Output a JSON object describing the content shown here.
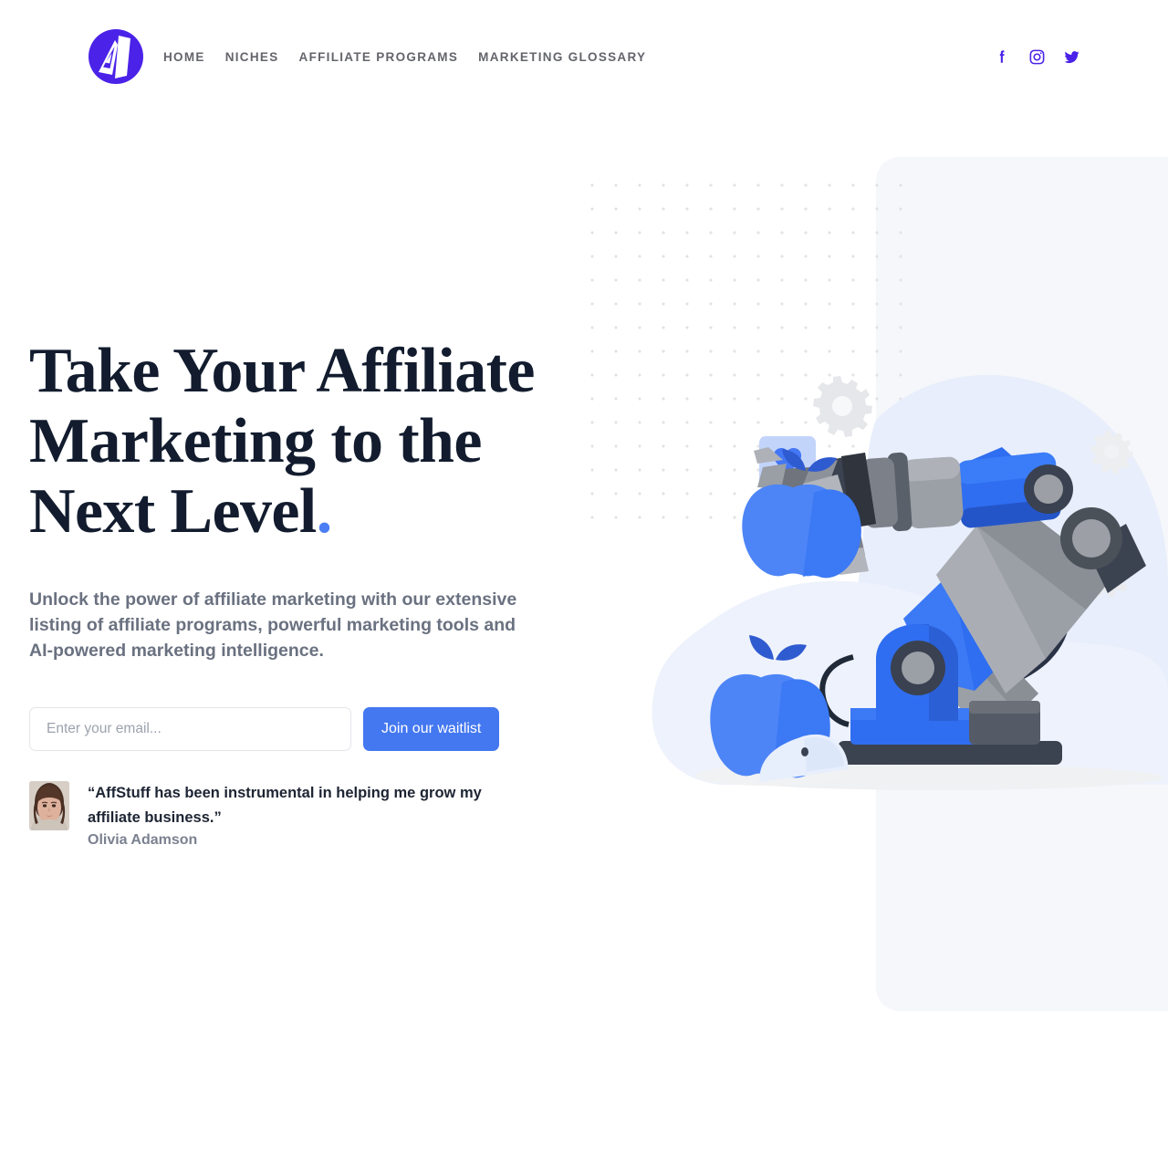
{
  "header": {
    "logo": {
      "icon": "affstuff-logo-icon",
      "alt": "AffStuff",
      "color": "#4b22e8"
    },
    "nav": [
      {
        "label": "HOME",
        "name": "nav-link-home"
      },
      {
        "label": "NICHES",
        "name": "nav-link-niches"
      },
      {
        "label": "AFFILIATE PROGRAMS",
        "name": "nav-link-affiliate-programs"
      },
      {
        "label": "MARKETING GLOSSARY",
        "name": "nav-link-marketing-glossary"
      }
    ],
    "socials": [
      {
        "icon": "facebook-icon",
        "label": "Facebook"
      },
      {
        "icon": "instagram-icon",
        "label": "Instagram"
      },
      {
        "icon": "twitter-icon",
        "label": "Twitter"
      }
    ],
    "social_color": "#4b22e8"
  },
  "hero": {
    "headline_line1": "Take Your Affiliate",
    "headline_line2": "Marketing to the",
    "headline_line3": "Next Level",
    "headline_period": ".",
    "subheading": "Unlock the power of affiliate marketing with our extensive listing of affiliate programs, powerful marketing tools and AI-powered marketing intelligence.",
    "form": {
      "email_placeholder": "Enter your email...",
      "email_value": "",
      "submit_label": "Join our waitlist"
    },
    "testimonial": {
      "quote": "“AffStuff has been instrumental in helping me grow my affiliate business.”",
      "author": "Olivia Adamson",
      "avatar": "avatar-olivia-adamson"
    }
  },
  "illustration": {
    "name": "robot-arm-holding-apple-illustration",
    "elements": [
      "dot-grid-pattern",
      "background-panel",
      "blue-blob",
      "heart-speech-bubble",
      "gear-decoration",
      "robotic-arm",
      "blue-apple",
      "apple-slice"
    ]
  },
  "colors": {
    "accent_blue": "#4478f0",
    "brand_purple": "#4b22e8",
    "headline": "#121c2e",
    "body_text": "#6a7180",
    "panel_bg": "#f5f7fa",
    "blob_blue": "#e8eefb",
    "bubble_blue": "#c3d4fb"
  }
}
